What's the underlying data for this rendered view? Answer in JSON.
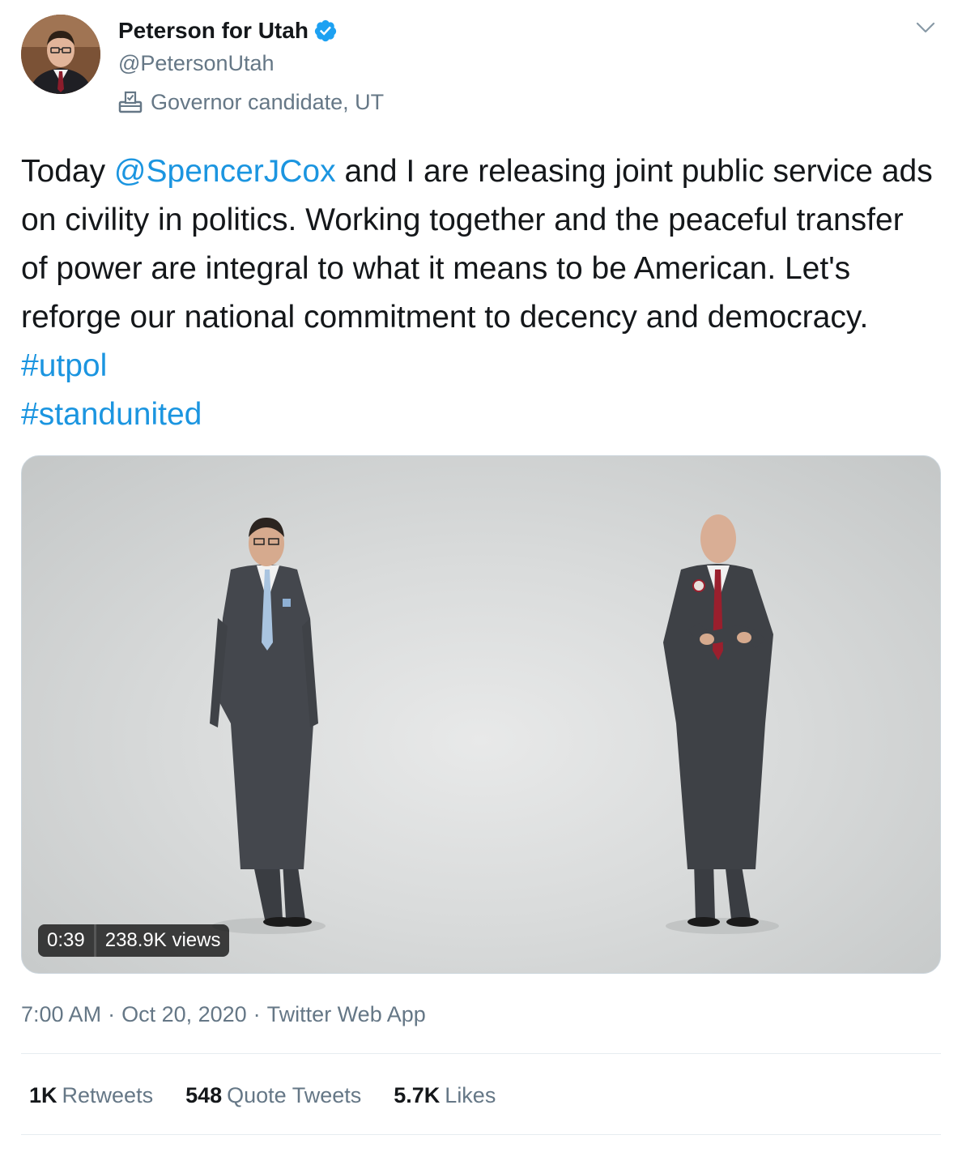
{
  "author": {
    "display_name": "Peterson for Utah",
    "handle": "@PetersonUtah",
    "label": "Governor candidate, UT",
    "verified_icon": "verified-badge-icon",
    "label_icon": "ballot-box-icon"
  },
  "tweet": {
    "text_parts": {
      "p1": "Today ",
      "mention": "@SpencerJCox",
      "p2": " and I are releasing joint public service ads on civility in politics. Working together and the peaceful transfer of power are integral to what it means to be American. Let's reforge our national commitment to decency and democracy. ",
      "hashtag1": "#utpol",
      "hashtag2": "#standunited"
    }
  },
  "media": {
    "duration": "0:39",
    "views": "238.9K views"
  },
  "meta": {
    "time": "7:00 AM",
    "date": "Oct 20, 2020",
    "source": "Twitter Web App",
    "separator": "·"
  },
  "stats": {
    "retweets_count": "1K",
    "retweets_label": "Retweets",
    "quotes_count": "548",
    "quotes_label": "Quote Tweets",
    "likes_count": "5.7K",
    "likes_label": "Likes"
  },
  "colors": {
    "link": "#1b95e0",
    "secondary": "#657786",
    "verified": "#1da1f2"
  }
}
